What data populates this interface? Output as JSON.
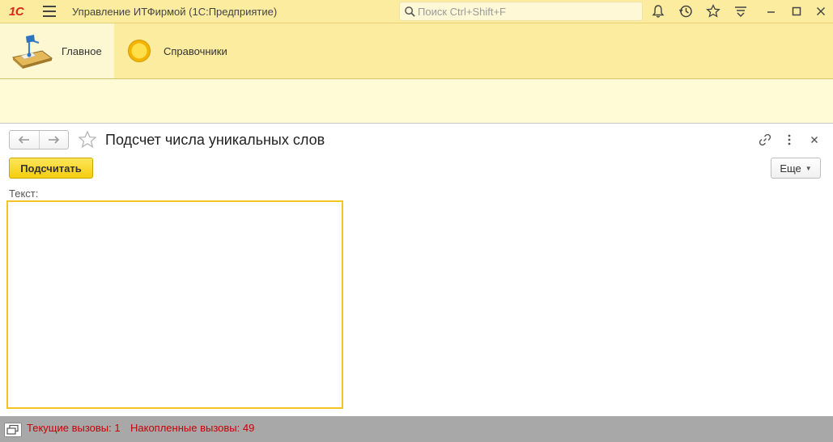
{
  "titlebar": {
    "logo": "1С",
    "app_title": "Управление ИТФирмой  (1С:Предприятие)",
    "search_placeholder": "Поиск Ctrl+Shift+F"
  },
  "sections": [
    {
      "label": "Главное",
      "icon": "desk-lamp-icon",
      "active": true
    },
    {
      "label": "Справочники",
      "icon": "yellow-circle-icon",
      "active": false
    }
  ],
  "form": {
    "title": "Подсчет числа уникальных слов",
    "count_button": "Подсчитать",
    "more_button": "Еще",
    "text_label": "Текст:",
    "text_value": ""
  },
  "statusbar": {
    "current_calls": "Текущие вызовы: 1",
    "accumulated_calls": "Накопленные вызовы: 49"
  },
  "colors": {
    "panel_yellow": "#fbec9f",
    "accent_button": "#f5cd0e",
    "status_text": "#c8000a"
  }
}
